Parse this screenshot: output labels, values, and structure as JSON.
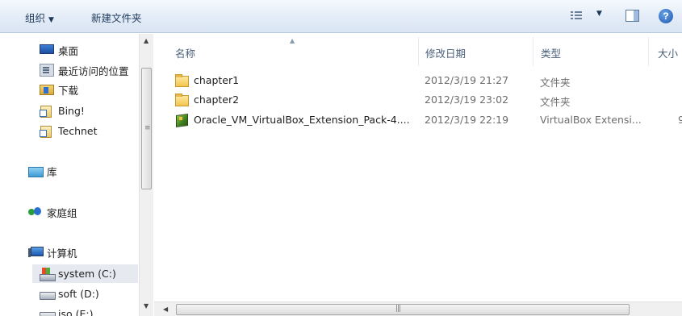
{
  "toolbar": {
    "organize_label": "组织",
    "new_folder_label": "新建文件夹",
    "view_icon": "view-options-icon",
    "preview_icon": "preview-pane-icon",
    "help_icon": "help-icon"
  },
  "nav": {
    "items": [
      {
        "label": "桌面",
        "icon": "desktop-icon"
      },
      {
        "label": "最近访问的位置",
        "icon": "recent-places-icon"
      },
      {
        "label": "下载",
        "icon": "downloads-icon"
      },
      {
        "label": "Bing!",
        "icon": "shortcut-icon"
      },
      {
        "label": "Technet",
        "icon": "shortcut-icon"
      },
      {
        "label": "库",
        "icon": "libraries-icon"
      },
      {
        "label": "家庭组",
        "icon": "homegroup-icon"
      },
      {
        "label": "计算机",
        "icon": "computer-icon"
      },
      {
        "label": "system (C:)",
        "icon": "system-drive-icon"
      },
      {
        "label": "soft (D:)",
        "icon": "drive-icon"
      },
      {
        "label": "iso (E:)",
        "icon": "drive-icon"
      }
    ]
  },
  "columns": {
    "name": "名称",
    "modified": "修改日期",
    "type": "类型",
    "size": "大小"
  },
  "files": [
    {
      "name": "chapter1",
      "modified": "2012/3/19 21:27",
      "type": "文件夹",
      "size": "",
      "icon": "folder-icon"
    },
    {
      "name": "chapter2",
      "modified": "2012/3/19 23:02",
      "type": "文件夹",
      "size": "",
      "icon": "folder-icon"
    },
    {
      "name": "Oracle_VM_VirtualBox_Extension_Pack-4....",
      "modified": "2012/3/19 22:19",
      "type": "VirtualBox Extensi...",
      "size": "9",
      "icon": "virtualbox-extension-icon"
    }
  ]
}
